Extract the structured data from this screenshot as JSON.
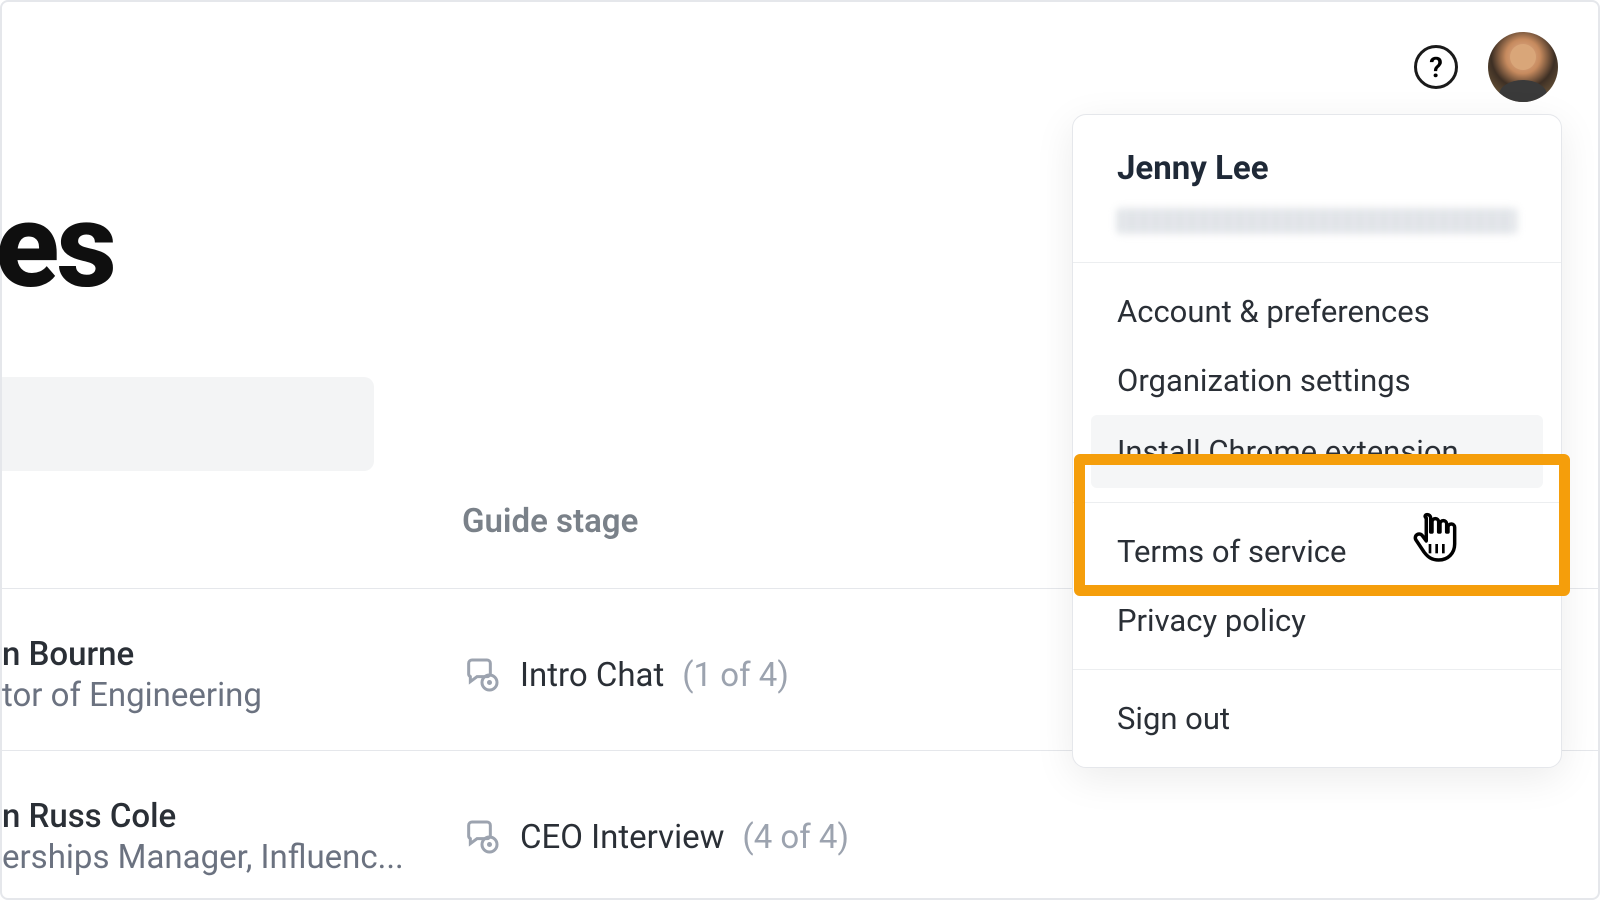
{
  "header": {
    "help_label": "?"
  },
  "page": {
    "title_fragment": "des"
  },
  "columns": {
    "guide_stage": "Guide stage"
  },
  "rows": [
    {
      "name_fragment": "n Bourne",
      "role_fragment": "tor of Engineering",
      "stage_name": "Intro Chat",
      "stage_progress": "(1 of 4)"
    },
    {
      "name_fragment": "n Russ Cole",
      "role_fragment": "erships Manager, Influenc...",
      "stage_name": "CEO Interview",
      "stage_progress": "(4 of 4)"
    }
  ],
  "dropdown": {
    "user_name": "Jenny Lee",
    "items_group1": [
      "Account & preferences",
      "Organization settings"
    ],
    "install_label": "Install Chrome extension",
    "items_group2": [
      "Terms of service",
      "Privacy policy"
    ],
    "sign_out": "Sign out"
  },
  "colors": {
    "highlight": "#f59e0b",
    "text_primary": "#1f2937",
    "text_muted": "#6b7280"
  }
}
